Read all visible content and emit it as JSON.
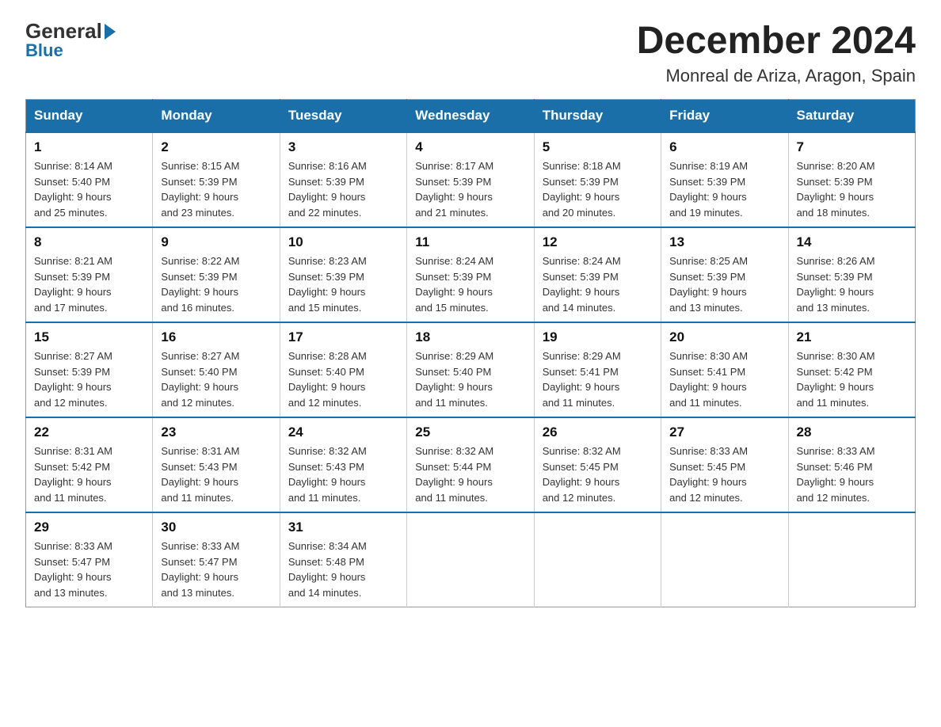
{
  "header": {
    "logo_general": "General",
    "logo_blue": "Blue",
    "title": "December 2024",
    "subtitle": "Monreal de Ariza, Aragon, Spain"
  },
  "days_of_week": [
    "Sunday",
    "Monday",
    "Tuesday",
    "Wednesday",
    "Thursday",
    "Friday",
    "Saturday"
  ],
  "weeks": [
    [
      {
        "day": "1",
        "sunrise": "8:14 AM",
        "sunset": "5:40 PM",
        "daylight_hours": "9 hours",
        "daylight_minutes": "and 25 minutes."
      },
      {
        "day": "2",
        "sunrise": "8:15 AM",
        "sunset": "5:39 PM",
        "daylight_hours": "9 hours",
        "daylight_minutes": "and 23 minutes."
      },
      {
        "day": "3",
        "sunrise": "8:16 AM",
        "sunset": "5:39 PM",
        "daylight_hours": "9 hours",
        "daylight_minutes": "and 22 minutes."
      },
      {
        "day": "4",
        "sunrise": "8:17 AM",
        "sunset": "5:39 PM",
        "daylight_hours": "9 hours",
        "daylight_minutes": "and 21 minutes."
      },
      {
        "day": "5",
        "sunrise": "8:18 AM",
        "sunset": "5:39 PM",
        "daylight_hours": "9 hours",
        "daylight_minutes": "and 20 minutes."
      },
      {
        "day": "6",
        "sunrise": "8:19 AM",
        "sunset": "5:39 PM",
        "daylight_hours": "9 hours",
        "daylight_minutes": "and 19 minutes."
      },
      {
        "day": "7",
        "sunrise": "8:20 AM",
        "sunset": "5:39 PM",
        "daylight_hours": "9 hours",
        "daylight_minutes": "and 18 minutes."
      }
    ],
    [
      {
        "day": "8",
        "sunrise": "8:21 AM",
        "sunset": "5:39 PM",
        "daylight_hours": "9 hours",
        "daylight_minutes": "and 17 minutes."
      },
      {
        "day": "9",
        "sunrise": "8:22 AM",
        "sunset": "5:39 PM",
        "daylight_hours": "9 hours",
        "daylight_minutes": "and 16 minutes."
      },
      {
        "day": "10",
        "sunrise": "8:23 AM",
        "sunset": "5:39 PM",
        "daylight_hours": "9 hours",
        "daylight_minutes": "and 15 minutes."
      },
      {
        "day": "11",
        "sunrise": "8:24 AM",
        "sunset": "5:39 PM",
        "daylight_hours": "9 hours",
        "daylight_minutes": "and 15 minutes."
      },
      {
        "day": "12",
        "sunrise": "8:24 AM",
        "sunset": "5:39 PM",
        "daylight_hours": "9 hours",
        "daylight_minutes": "and 14 minutes."
      },
      {
        "day": "13",
        "sunrise": "8:25 AM",
        "sunset": "5:39 PM",
        "daylight_hours": "9 hours",
        "daylight_minutes": "and 13 minutes."
      },
      {
        "day": "14",
        "sunrise": "8:26 AM",
        "sunset": "5:39 PM",
        "daylight_hours": "9 hours",
        "daylight_minutes": "and 13 minutes."
      }
    ],
    [
      {
        "day": "15",
        "sunrise": "8:27 AM",
        "sunset": "5:39 PM",
        "daylight_hours": "9 hours",
        "daylight_minutes": "and 12 minutes."
      },
      {
        "day": "16",
        "sunrise": "8:27 AM",
        "sunset": "5:40 PM",
        "daylight_hours": "9 hours",
        "daylight_minutes": "and 12 minutes."
      },
      {
        "day": "17",
        "sunrise": "8:28 AM",
        "sunset": "5:40 PM",
        "daylight_hours": "9 hours",
        "daylight_minutes": "and 12 minutes."
      },
      {
        "day": "18",
        "sunrise": "8:29 AM",
        "sunset": "5:40 PM",
        "daylight_hours": "9 hours",
        "daylight_minutes": "and 11 minutes."
      },
      {
        "day": "19",
        "sunrise": "8:29 AM",
        "sunset": "5:41 PM",
        "daylight_hours": "9 hours",
        "daylight_minutes": "and 11 minutes."
      },
      {
        "day": "20",
        "sunrise": "8:30 AM",
        "sunset": "5:41 PM",
        "daylight_hours": "9 hours",
        "daylight_minutes": "and 11 minutes."
      },
      {
        "day": "21",
        "sunrise": "8:30 AM",
        "sunset": "5:42 PM",
        "daylight_hours": "9 hours",
        "daylight_minutes": "and 11 minutes."
      }
    ],
    [
      {
        "day": "22",
        "sunrise": "8:31 AM",
        "sunset": "5:42 PM",
        "daylight_hours": "9 hours",
        "daylight_minutes": "and 11 minutes."
      },
      {
        "day": "23",
        "sunrise": "8:31 AM",
        "sunset": "5:43 PM",
        "daylight_hours": "9 hours",
        "daylight_minutes": "and 11 minutes."
      },
      {
        "day": "24",
        "sunrise": "8:32 AM",
        "sunset": "5:43 PM",
        "daylight_hours": "9 hours",
        "daylight_minutes": "and 11 minutes."
      },
      {
        "day": "25",
        "sunrise": "8:32 AM",
        "sunset": "5:44 PM",
        "daylight_hours": "9 hours",
        "daylight_minutes": "and 11 minutes."
      },
      {
        "day": "26",
        "sunrise": "8:32 AM",
        "sunset": "5:45 PM",
        "daylight_hours": "9 hours",
        "daylight_minutes": "and 12 minutes."
      },
      {
        "day": "27",
        "sunrise": "8:33 AM",
        "sunset": "5:45 PM",
        "daylight_hours": "9 hours",
        "daylight_minutes": "and 12 minutes."
      },
      {
        "day": "28",
        "sunrise": "8:33 AM",
        "sunset": "5:46 PM",
        "daylight_hours": "9 hours",
        "daylight_minutes": "and 12 minutes."
      }
    ],
    [
      {
        "day": "29",
        "sunrise": "8:33 AM",
        "sunset": "5:47 PM",
        "daylight_hours": "9 hours",
        "daylight_minutes": "and 13 minutes."
      },
      {
        "day": "30",
        "sunrise": "8:33 AM",
        "sunset": "5:47 PM",
        "daylight_hours": "9 hours",
        "daylight_minutes": "and 13 minutes."
      },
      {
        "day": "31",
        "sunrise": "8:34 AM",
        "sunset": "5:48 PM",
        "daylight_hours": "9 hours",
        "daylight_minutes": "and 14 minutes."
      },
      null,
      null,
      null,
      null
    ]
  ],
  "labels": {
    "sunrise": "Sunrise:",
    "sunset": "Sunset:",
    "daylight": "Daylight:"
  }
}
